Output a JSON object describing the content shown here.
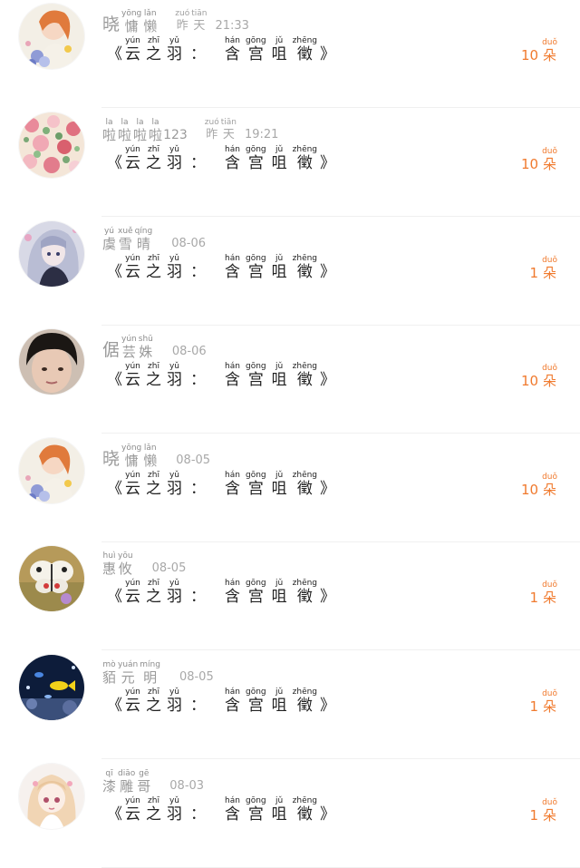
{
  "gift_name_parts": {
    "open_bracket": "《",
    "close_bracket": "》",
    "colon": "：",
    "chars": [
      {
        "py": "yún",
        "hz": "云"
      },
      {
        "py": "zhī",
        "hz": "之"
      },
      {
        "py": "yǔ",
        "hz": "羽"
      }
    ],
    "chars2": [
      {
        "py": "hán",
        "hz": "含"
      },
      {
        "py": "gōng",
        "hz": "宫"
      },
      {
        "py": "jǔ",
        "hz": "咀"
      },
      {
        "py": "zhēng",
        "hz": "徵"
      }
    ]
  },
  "unit": {
    "py": "duǒ",
    "hz": "朵"
  },
  "records": [
    {
      "user": [
        {
          "hz": "晓",
          "py": "",
          "big": true
        },
        {
          "hz": "慵",
          "py": "yōng"
        },
        {
          "hz": "懒",
          "py": "lǎn"
        }
      ],
      "time_ruby": [
        {
          "hz": "昨",
          "py": "zuó"
        },
        {
          "hz": "天",
          "py": "tiān"
        }
      ],
      "time_text": "21:33",
      "amount": "10",
      "avatar": "girl-flowers"
    },
    {
      "user": [
        {
          "hz": "啦",
          "py": "la"
        },
        {
          "hz": "啦",
          "py": "la"
        },
        {
          "hz": "啦",
          "py": "la"
        },
        {
          "hz": "啦",
          "py": "la"
        }
      ],
      "user_suffix": "123",
      "time_ruby": [
        {
          "hz": "昨",
          "py": "zuó"
        },
        {
          "hz": "天",
          "py": "tiān"
        }
      ],
      "time_text": "19:21",
      "amount": "10",
      "avatar": "floral-pattern"
    },
    {
      "user": [
        {
          "hz": "虞",
          "py": "yú"
        },
        {
          "hz": "雪",
          "py": "xuě"
        },
        {
          "hz": "晴",
          "py": "qíng"
        }
      ],
      "time_text": "08-06",
      "amount": "1",
      "avatar": "anime-silver-hair"
    },
    {
      "user": [
        {
          "hz": "倨",
          "py": "",
          "big": true
        },
        {
          "hz": "芸",
          "py": "yún"
        },
        {
          "hz": "姝",
          "py": "shū"
        }
      ],
      "time_text": "08-06",
      "amount": "10",
      "avatar": "dark-hair-face"
    },
    {
      "user": [
        {
          "hz": "晓",
          "py": "",
          "big": true
        },
        {
          "hz": "慵",
          "py": "yōng"
        },
        {
          "hz": "懒",
          "py": "lǎn"
        }
      ],
      "time_text": "08-05",
      "amount": "10",
      "avatar": "girl-flowers"
    },
    {
      "user": [
        {
          "hz": "惠",
          "py": "huì"
        },
        {
          "hz": "攸",
          "py": "yōu"
        }
      ],
      "time_text": "08-05",
      "amount": "1",
      "avatar": "butterfly"
    },
    {
      "user": [
        {
          "hz": "貊",
          "py": "mò"
        },
        {
          "hz": "元",
          "py": "yuán"
        },
        {
          "hz": "明",
          "py": "míng"
        }
      ],
      "time_text": "08-05",
      "amount": "1",
      "avatar": "underwater-fish"
    },
    {
      "user": [
        {
          "hz": "漆",
          "py": "qī"
        },
        {
          "hz": "雕",
          "py": "diāo"
        },
        {
          "hz": "哥",
          "py": "gē"
        }
      ],
      "time_text": "08-03",
      "amount": "1",
      "avatar": "anime-blonde-girl"
    }
  ],
  "colors": {
    "amount": "#f07a2e",
    "name": "#9a9a9a",
    "gift": "#222222",
    "divider": "#f0f0f0"
  }
}
